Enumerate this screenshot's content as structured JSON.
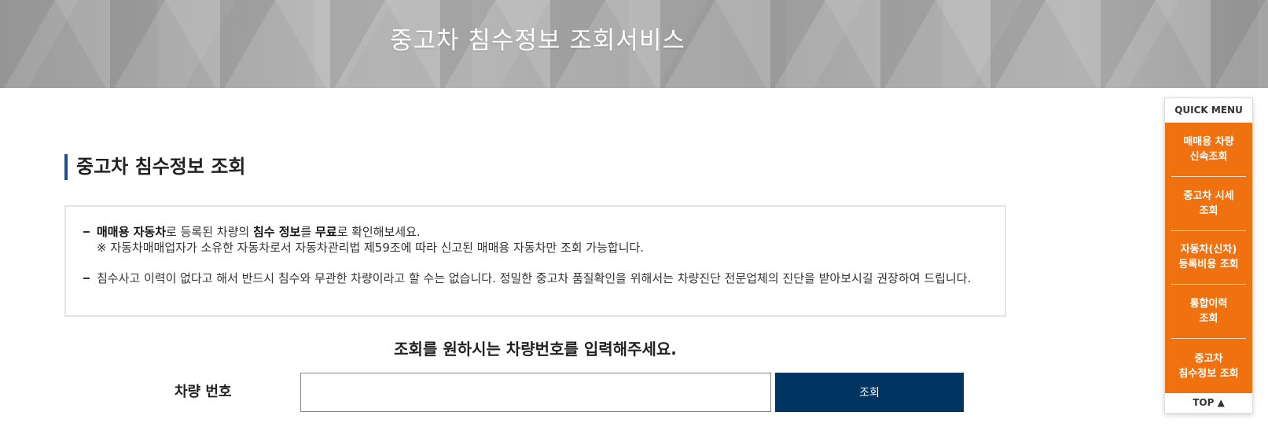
{
  "banner": {
    "title": "중고차 침수정보 조회서비스"
  },
  "section": {
    "title": "중고차 침수정보 조회"
  },
  "notice": {
    "item1": {
      "b1": "매매용 자동차",
      "t1": "로 등록된 차량의 ",
      "b2": "침수 정보",
      "t2": "를 ",
      "b3": "무료",
      "t3": "로 확인해보세요.",
      "line2": "※ 자동차매매업자가 소유한 자동차로서 자동차관리법 제59조에 따라 신고된 매매용 자동차만 조회 가능합니다."
    },
    "item2": {
      "text": "침수사고 이력이 없다고 해서 반드시 침수와 무관한 차량이라고 할 수는 없습니다. 정밀한 중고차 품질확인을 위해서는 차량진단 전문업체의 진단을 받아보시길 권장하여 드립니다."
    }
  },
  "prompt": "조회를 원하시는 차량번호를 입력해주세요.",
  "form": {
    "label": "차량 번호",
    "input_value": "",
    "button_label": "조회"
  },
  "quick_menu": {
    "title": "QUICK MENU",
    "items": [
      {
        "label": "매매용 차량\n신속조회"
      },
      {
        "label": "중고차 시세\n조회"
      },
      {
        "label": "자동차(신차)\n등록비용 조회"
      },
      {
        "label": "통합이력\n조회"
      },
      {
        "label": "중고차\n침수정보 조회"
      }
    ],
    "top_label": "TOP ▲"
  },
  "colors": {
    "accent_orange": "#f07110",
    "button_navy": "#003561",
    "title_bar": "#1f4e8c"
  }
}
